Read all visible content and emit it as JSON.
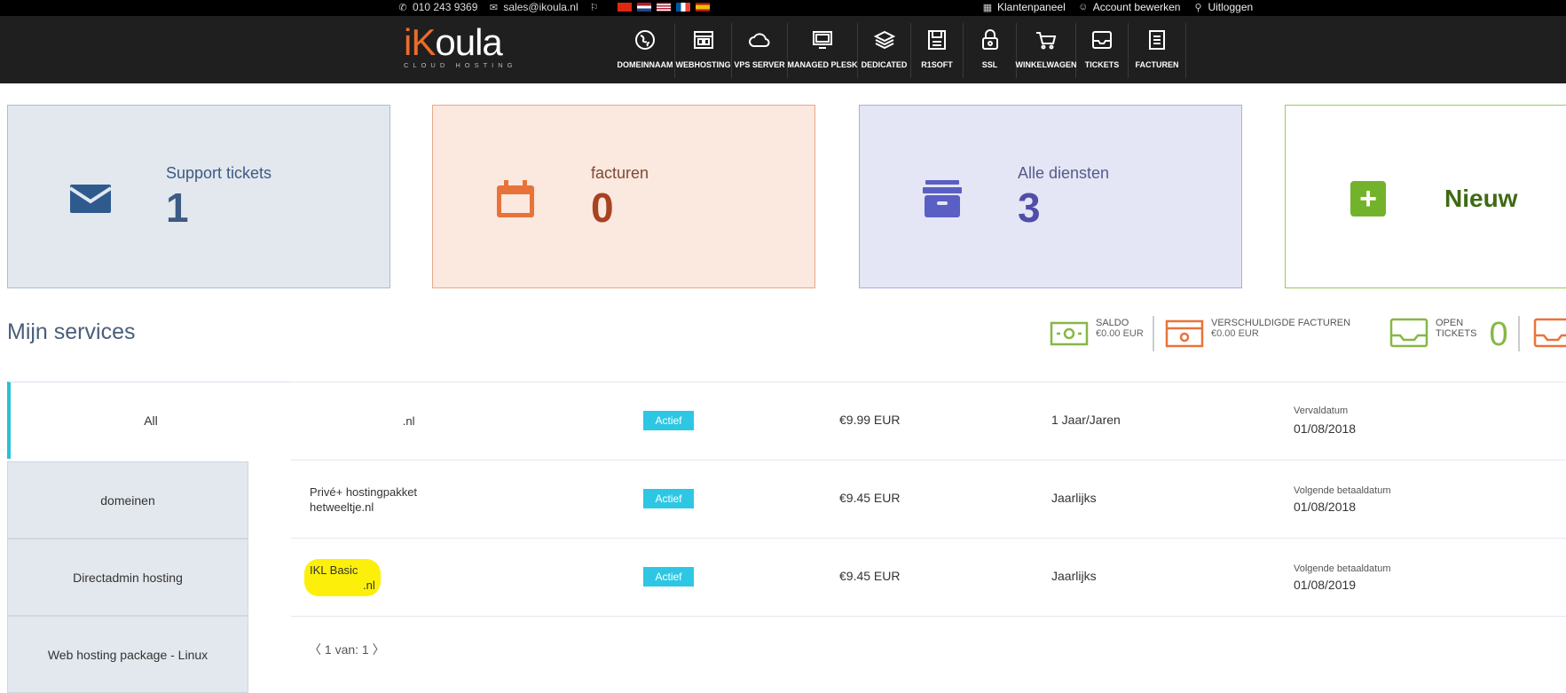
{
  "topbar": {
    "phone": "010 243 9369",
    "email": "sales@ikoula.nl",
    "right": {
      "panel": "Klantenpaneel",
      "account": "Account bewerken",
      "logout": "Uitloggen"
    },
    "icons": [
      "phone-icon",
      "mail-icon",
      "flag-icon"
    ]
  },
  "logo": {
    "brand": "ikoula",
    "tagline": "CLOUD HOSTING"
  },
  "nav": [
    {
      "label": "DOMEINNAAM",
      "icon": "globe-icon"
    },
    {
      "label": "WEBHOSTING",
      "icon": "layout-icon"
    },
    {
      "label": "VPS SERVER",
      "icon": "cloud-icon"
    },
    {
      "label": "MANAGED PLESK",
      "icon": "monitor-icon"
    },
    {
      "label": "DEDICATED",
      "icon": "layers-icon"
    },
    {
      "label": "R1SOFT",
      "icon": "floppy-icon"
    },
    {
      "label": "SSL",
      "icon": "lock-icon"
    },
    {
      "label": "WINKELWAGEN",
      "icon": "cart-icon"
    },
    {
      "label": "TICKETS",
      "icon": "inbox-icon"
    },
    {
      "label": "FACTUREN",
      "icon": "document-icon"
    }
  ],
  "cards": {
    "tickets": {
      "label": "Support tickets",
      "value": "1"
    },
    "invoices": {
      "label": "facturen",
      "value": "0"
    },
    "services": {
      "label": "Alle diensten",
      "value": "3"
    },
    "new": {
      "label": "Nieuw"
    }
  },
  "services_title": "Mijn services",
  "stats": {
    "saldo": {
      "label": "SALDO",
      "value": "€0.00 EUR"
    },
    "verschuldigde": {
      "label": "VERSCHULDIGDE FACTUREN",
      "value": "€0.00 EUR"
    },
    "open": {
      "label1": "OPEN",
      "label2": "TICKETS",
      "value": "0"
    }
  },
  "sidebar": [
    "All",
    "domeinen",
    "Directadmin hosting",
    "Web hosting package - Linux"
  ],
  "rows": [
    {
      "line1": ".nl",
      "line2": "",
      "status": "Actief",
      "price": "€9.99 EUR",
      "cycle": "1 Jaar/Jaren",
      "date_label": "Vervaldatum",
      "date": "01/08/2018"
    },
    {
      "line1": "Privé+ hostingpakket",
      "line2": "hetweeltje.nl",
      "status": "Actief",
      "price": "€9.45 EUR",
      "cycle": "Jaarlijks",
      "date_label": "Volgende betaaldatum",
      "date": "01/08/2018"
    },
    {
      "line1": "IKL Basic",
      "line2": ".nl",
      "status": "Actief",
      "price": "€9.45 EUR",
      "cycle": "Jaarlijks",
      "date_label": "Volgende betaaldatum",
      "date": "01/08/2019"
    }
  ],
  "pager": {
    "text": "1 van: 1",
    "prev": "〈",
    "next": "〉"
  }
}
